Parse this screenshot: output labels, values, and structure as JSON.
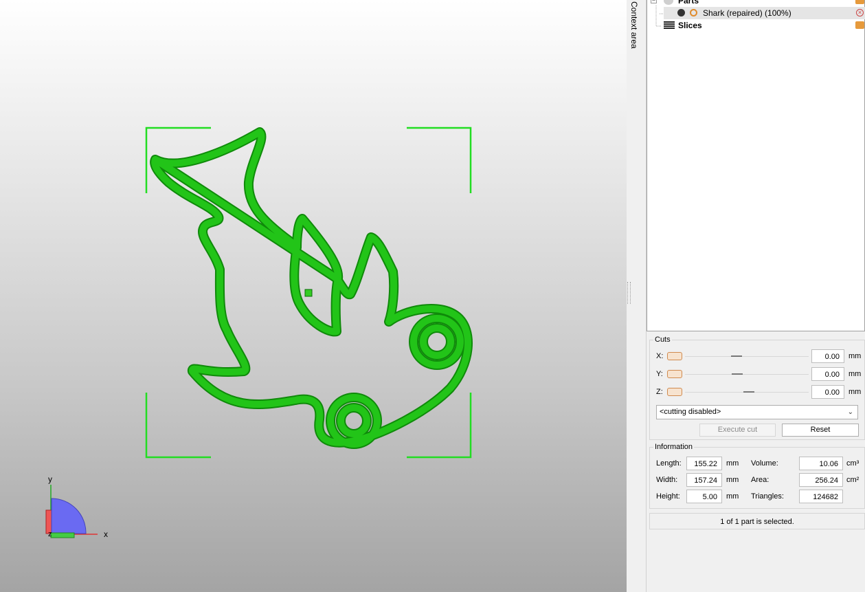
{
  "context_tab": {
    "label": "Context area"
  },
  "tree": {
    "items": [
      {
        "label": "Parts",
        "icon": "parts-icon"
      },
      {
        "label": "Shark (repaired) (100%)",
        "icon": "part-icon",
        "selected": true
      },
      {
        "label": "Slices",
        "icon": "slices-icon"
      }
    ]
  },
  "cuts": {
    "title": "Cuts",
    "axes": [
      {
        "label": "X:",
        "value": "0.00",
        "unit": "mm"
      },
      {
        "label": "Y:",
        "value": "0.00",
        "unit": "mm"
      },
      {
        "label": "Z:",
        "value": "0.00",
        "unit": "mm"
      }
    ],
    "mode": "<cutting disabled>",
    "execute_label": "Execute cut",
    "reset_label": "Reset"
  },
  "information": {
    "title": "Information",
    "length": {
      "label": "Length:",
      "value": "155.22",
      "unit": "mm"
    },
    "width": {
      "label": "Width:",
      "value": "157.24",
      "unit": "mm"
    },
    "height": {
      "label": "Height:",
      "value": "5.00",
      "unit": "mm"
    },
    "volume": {
      "label": "Volume:",
      "value": "10.06",
      "unit": "cm³"
    },
    "area": {
      "label": "Area:",
      "value": "256.24",
      "unit": "cm²"
    },
    "triangles": {
      "label": "Triangles:",
      "value": "124682"
    }
  },
  "status": {
    "text": "1 of 1 part is selected."
  },
  "axes_gizmo": {
    "x": "x",
    "y": "y",
    "z": "z"
  },
  "colors": {
    "model": "#22bb11",
    "selection": "#22dd22",
    "accent": "#d08a4e"
  }
}
